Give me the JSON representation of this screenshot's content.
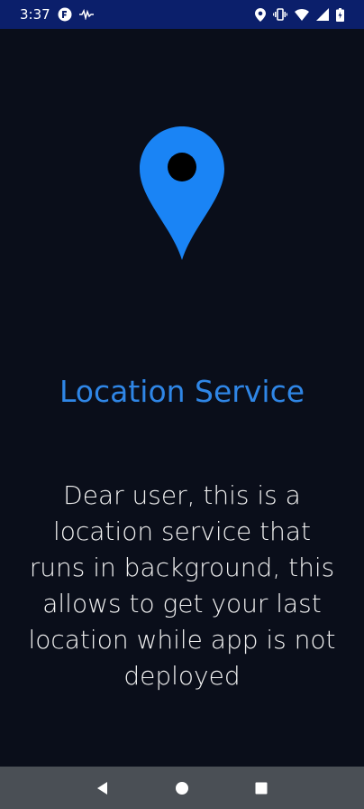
{
  "status_bar": {
    "time": "3:37",
    "icons": [
      "app-icon",
      "waveform-icon",
      "location-icon",
      "vibrate-icon",
      "wifi-icon",
      "signal-icon",
      "battery-icon"
    ]
  },
  "main": {
    "icon": "location-pin-icon",
    "title": "Location Service",
    "description": "Dear user, this is a location service that runs in background, this allows to get your last location while app is not deployed"
  },
  "nav_bar": {
    "buttons": [
      "back",
      "home",
      "recents"
    ]
  },
  "colors": {
    "background": "#0a0e1a",
    "status_bar": "#0b1f6b",
    "accent": "#2f86e6",
    "pin": "#1a84f5",
    "nav_bar": "#4a4f55"
  }
}
